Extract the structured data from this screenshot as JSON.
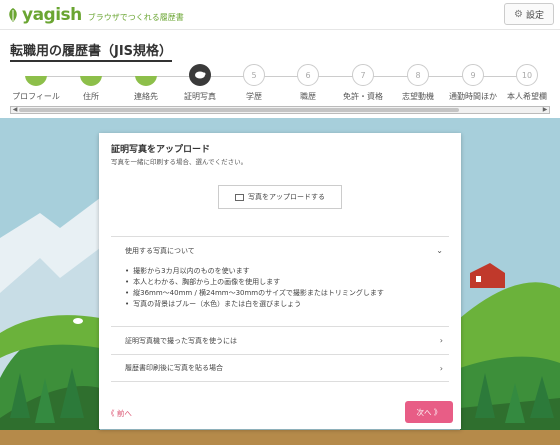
{
  "header": {
    "logo_text": "yagish",
    "tagline": "ブラウザでつくれる履歴書",
    "settings_label": "設定"
  },
  "page_title": "転職用の履歴書（JIS規格）",
  "steps": [
    {
      "label": "プロフィール",
      "number": "",
      "state": "done"
    },
    {
      "label": "住所",
      "number": "",
      "state": "done"
    },
    {
      "label": "連絡先",
      "number": "",
      "state": "done"
    },
    {
      "label": "証明写真",
      "number": "",
      "state": "current"
    },
    {
      "label": "学歴",
      "number": "5",
      "state": "todo"
    },
    {
      "label": "職歴",
      "number": "6",
      "state": "todo"
    },
    {
      "label": "免許・資格",
      "number": "7",
      "state": "todo"
    },
    {
      "label": "志望動機",
      "number": "8",
      "state": "todo"
    },
    {
      "label": "通勤時間ほか",
      "number": "9",
      "state": "todo"
    },
    {
      "label": "本人希望欄",
      "number": "10",
      "state": "todo"
    }
  ],
  "modal": {
    "title": "証明写真をアップロード",
    "subtitle": "写真を一緒に印刷する場合、選んでください。",
    "upload_label": "写真をアップロードする",
    "sections": [
      {
        "title": "使用する写真について",
        "expanded": true
      },
      {
        "title": "証明写真機で撮った写真を使うには",
        "expanded": false
      },
      {
        "title": "履歴書印刷後に写真を貼る場合",
        "expanded": false
      }
    ],
    "rules": [
      "撮影から3カ月以内のものを使います",
      "本人とわかる、胸部から上の画像を使用します",
      "縦36mm〜40mm / 横24mm〜30mmのサイズで撮影またはトリミングします",
      "写真の背景はブルー（水色）または白を選びましょう"
    ],
    "prev_label": "《 前へ",
    "next_label": "次へ 》"
  },
  "colors": {
    "brand": "#6aa532",
    "accent_pink": "#e85d86",
    "step_current": "#3a3a3a"
  }
}
